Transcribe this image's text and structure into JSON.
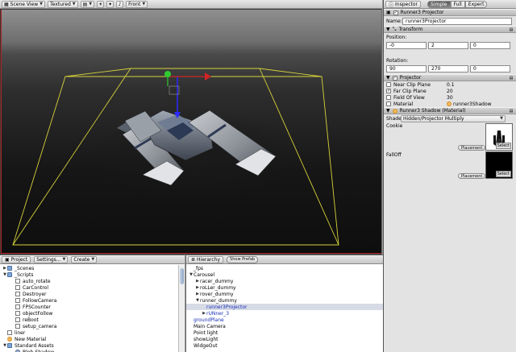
{
  "scene": {
    "view_mode": "Scene View",
    "shading": "Textured",
    "camera": "Front",
    "toolbar_icons": [
      "image-effects-icon",
      "lighting-icon",
      "audio-icon"
    ]
  },
  "inspector": {
    "tab_label": "Inspector",
    "modes": [
      "Simple",
      "Full",
      "Expert"
    ],
    "active_mode": "Simple",
    "object_header": "Runner3 Projector",
    "name_label": "Name:",
    "name_value": "runner3Projector",
    "transform": {
      "title": "Transform",
      "position_label": "Position:",
      "position": [
        "-0",
        "2",
        "0"
      ],
      "rotation_label": "Rotation:",
      "rotation": [
        "90",
        "270",
        "0"
      ]
    },
    "projector": {
      "title": "Projector",
      "near_label": "Near Clip Plane",
      "near_value": "0.1",
      "far_label": "Far Clip Plane",
      "far_value": "20",
      "fov_label": "Field Of View",
      "fov_value": "30",
      "material_label": "Material",
      "material_value": "runner3Shadow"
    },
    "material": {
      "title": "Runner3 Shadow (Material)",
      "shader_label": "Shader",
      "shader_value": "Hidden/Projector Multiply",
      "cookie_label": "Cookie",
      "falloff_label": "FallOff",
      "placement_label": "Placement",
      "select_label": "Select"
    }
  },
  "project": {
    "tab_label": "Project",
    "settings_label": "Settings...",
    "create_label": "Create",
    "items": [
      {
        "label": "_Scenes",
        "type": "folder",
        "indent": 0,
        "expanded": false
      },
      {
        "label": "_Scripts",
        "type": "folder",
        "indent": 0,
        "expanded": true
      },
      {
        "label": "auto_rotate",
        "type": "file",
        "indent": 1
      },
      {
        "label": "CarControl",
        "type": "file",
        "indent": 1
      },
      {
        "label": "Destroyer",
        "type": "file",
        "indent": 1
      },
      {
        "label": "FollowCamera",
        "type": "file",
        "indent": 1
      },
      {
        "label": "FPSCounter",
        "type": "file",
        "indent": 1
      },
      {
        "label": "objectFollow",
        "type": "file",
        "indent": 1
      },
      {
        "label": "reBoot",
        "type": "file",
        "indent": 1
      },
      {
        "label": "setup_camera",
        "type": "file",
        "indent": 1
      },
      {
        "label": "liner",
        "type": "file",
        "indent": 0
      },
      {
        "label": "New Material",
        "type": "material",
        "indent": 0
      },
      {
        "label": "Standard Assets",
        "type": "folder",
        "indent": 0,
        "expanded": true
      },
      {
        "label": "Blob-Shadow",
        "type": "package",
        "indent": 1
      }
    ]
  },
  "hierarchy": {
    "tab_label": "Hierarchy",
    "show_prefab_label": "Show Prefab",
    "items": [
      {
        "label": "_fps",
        "indent": 0
      },
      {
        "label": "Carousel",
        "indent": 0,
        "expanded": true
      },
      {
        "label": "racer_dummy",
        "indent": 1,
        "collapsed": true
      },
      {
        "label": "roLLer_dummy",
        "indent": 1,
        "collapsed": true
      },
      {
        "label": "rover_dummy",
        "indent": 1,
        "collapsed": true
      },
      {
        "label": "runner_dummy",
        "indent": 1,
        "expanded": true
      },
      {
        "label": "runner3Projector",
        "indent": 2,
        "selected": true,
        "blue": true
      },
      {
        "label": "rUNner_3",
        "indent": 2,
        "collapsed": true,
        "blue": true
      },
      {
        "label": "groundPlane",
        "indent": 0,
        "blue": true
      },
      {
        "label": "Main Camera",
        "indent": 0
      },
      {
        "label": "Point light",
        "indent": 0
      },
      {
        "label": "showLight",
        "indent": 0
      },
      {
        "label": "WidgeOut",
        "indent": 0
      }
    ]
  }
}
